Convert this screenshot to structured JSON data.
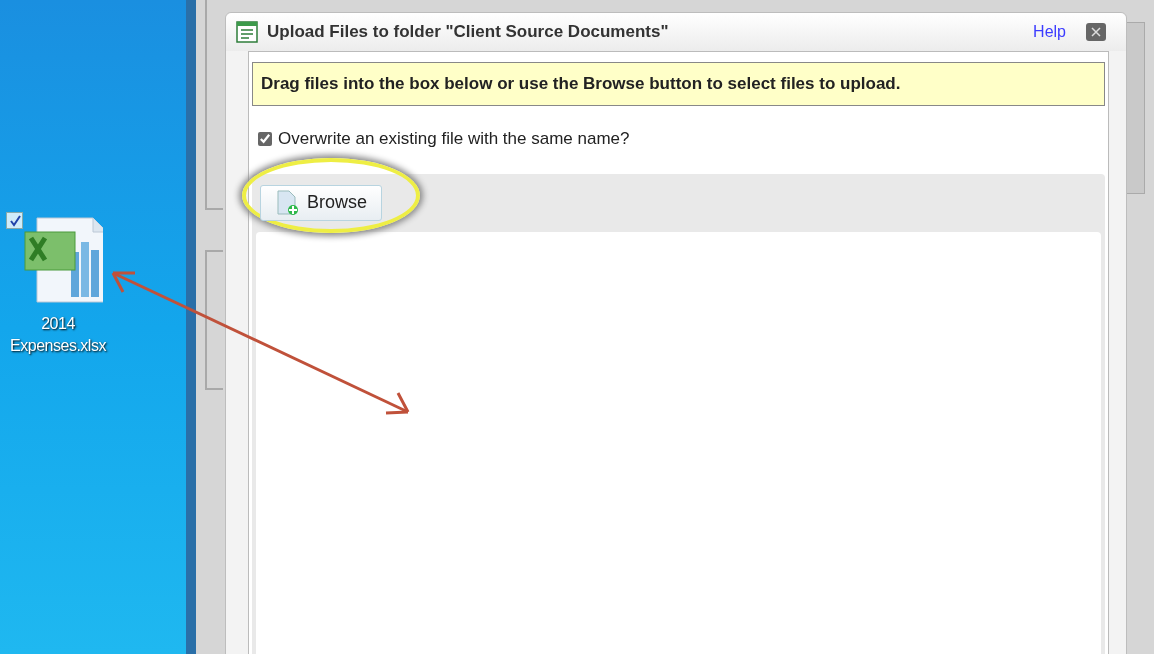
{
  "desktop_icons": [
    {
      "label": "2014 Expenses.xlsx",
      "checked": true
    }
  ],
  "dialog": {
    "title": "Upload Files to folder \"Client Source Documents\"",
    "help_link": "Help",
    "instruction": "Drag files into the box below or use the Browse button to select files to upload.",
    "overwrite": {
      "label": "Overwrite an existing file with the same name?",
      "checked": true
    },
    "browse_button": "Browse"
  }
}
